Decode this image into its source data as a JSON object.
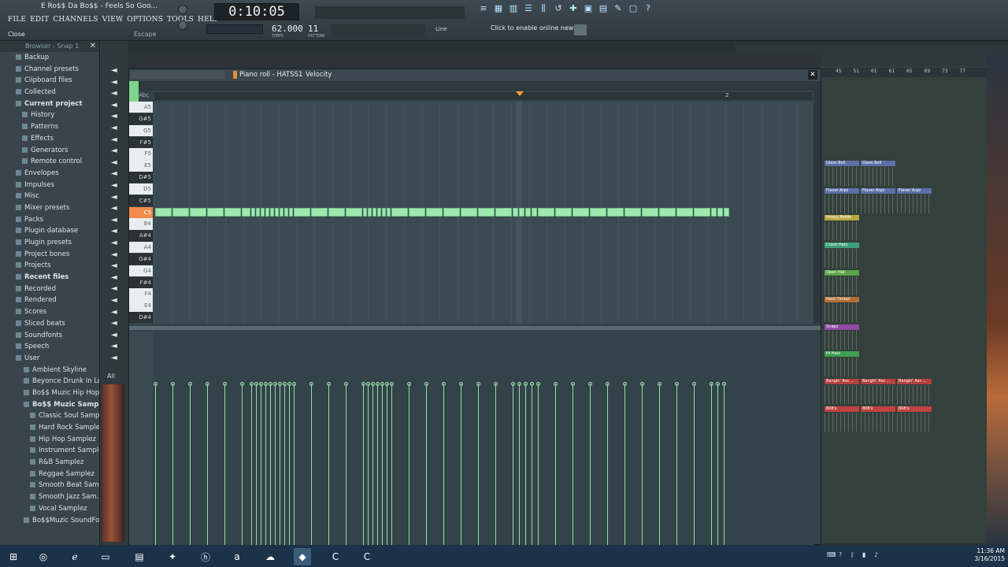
{
  "window": {
    "title": "E Ro$$ Da Bo$$ - Feels So Goo...",
    "menu": [
      "FILE",
      "EDIT",
      "CHANNELS",
      "VIEW",
      "OPTIONS",
      "TOOLS",
      "HELP"
    ],
    "hint_close": "Close",
    "hint_escape": "Escape"
  },
  "transport": {
    "time": "0:10:05",
    "tempo": "62.000",
    "tempo_label": "TEMPO",
    "pattern": "11",
    "pattern_label": "PATTERN",
    "mode": "Line",
    "news": "Click to enable online news"
  },
  "browser": {
    "header": "Browser - Snap 1",
    "items": [
      {
        "label": "Backup",
        "bold": false
      },
      {
        "label": "Channel presets",
        "bold": false
      },
      {
        "label": "Clipboard files",
        "bold": false
      },
      {
        "label": "Collected",
        "bold": false
      },
      {
        "label": "Current project",
        "bold": true
      },
      {
        "label": "History",
        "bold": false
      },
      {
        "label": "Patterns",
        "bold": false
      },
      {
        "label": "Effects",
        "bold": false
      },
      {
        "label": "Generators",
        "bold": false
      },
      {
        "label": "Remote control",
        "bold": false
      },
      {
        "label": "Envelopes",
        "bold": false
      },
      {
        "label": "Impulses",
        "bold": false
      },
      {
        "label": "Misc",
        "bold": false
      },
      {
        "label": "Mixer presets",
        "bold": false
      },
      {
        "label": "Packs",
        "bold": false
      },
      {
        "label": "Plugin database",
        "bold": false
      },
      {
        "label": "Plugin presets",
        "bold": false
      },
      {
        "label": "Project bones",
        "bold": false
      },
      {
        "label": "Projects",
        "bold": false
      },
      {
        "label": "Recent files",
        "bold": true
      },
      {
        "label": "Recorded",
        "bold": false
      },
      {
        "label": "Rendered",
        "bold": false
      },
      {
        "label": "Scores",
        "bold": false
      },
      {
        "label": "Sliced beats",
        "bold": false
      },
      {
        "label": "Soundfonts",
        "bold": false
      },
      {
        "label": "Speech",
        "bold": false
      },
      {
        "label": "User",
        "bold": false
      },
      {
        "label": "Ambient Skyline",
        "bold": false
      },
      {
        "label": "Beyonce Drunk In Lo...",
        "bold": false
      },
      {
        "label": "Bo$$ Muzic Hip Hop Kit",
        "bold": false
      },
      {
        "label": "Bo$$ Muzic Samplez",
        "bold": true
      },
      {
        "label": "Classic Soul Samp...",
        "bold": false
      },
      {
        "label": "Hard Rock Samplez",
        "bold": false
      },
      {
        "label": "Hip Hop Samplez",
        "bold": false
      },
      {
        "label": "Instrument Samplez",
        "bold": false
      },
      {
        "label": "R&B Samplez",
        "bold": false
      },
      {
        "label": "Reggae Samplez",
        "bold": false
      },
      {
        "label": "Smooth Beat Sam...",
        "bold": false
      },
      {
        "label": "Smooth Jazz Sam...",
        "bold": false
      },
      {
        "label": "Vocal Samplez",
        "bold": false
      },
      {
        "label": "Bo$$Muzic SoundFo...",
        "bold": false
      }
    ],
    "all_label": "All"
  },
  "piano_roll": {
    "title": "Piano roll - HATSS1",
    "target": "Velocity",
    "bar_label": "2",
    "keys": [
      "A5",
      "G#5",
      "G5",
      "F#5",
      "F5",
      "E5",
      "D#5",
      "D5",
      "C#5",
      "C5",
      "B4",
      "A#4",
      "A4",
      "G#4",
      "G4",
      "F#4",
      "F4",
      "E4",
      "D#4"
    ],
    "highlight_key": "C5",
    "note_row": "C5"
  },
  "playlist": {
    "ruler": [
      "45",
      "51",
      "61",
      "61",
      "65",
      "69",
      "73",
      "77"
    ],
    "clips": [
      {
        "label": "Glass Bell",
        "color": "#5f6fa8"
      },
      {
        "label": "Glass Bell",
        "color": "#5f6fa8"
      },
      {
        "label": "Flaver Arpz",
        "color": "#5f6fa8"
      },
      {
        "label": "Flaver Arpz",
        "color": "#5f6fa8"
      },
      {
        "label": "Flaver Arpz",
        "color": "#5f6fa8"
      },
      {
        "label": "Heavy Bottle",
        "color": "#b8a642"
      },
      {
        "label": "Crash Hatz",
        "color": "#3f9e7a"
      },
      {
        "label": "Open Hat",
        "color": "#5aa348"
      },
      {
        "label": "Hard Timbal",
        "color": "#b5703a"
      },
      {
        "label": "Snapz",
        "color": "#8d4ca6"
      },
      {
        "label": "Hi Hatz",
        "color": "#3f9e52"
      },
      {
        "label": "Bangin' Ass ...",
        "color": "#b2403e"
      },
      {
        "label": "Bangin' Ass ...",
        "color": "#b2403e"
      },
      {
        "label": "Bangin' Ass ...",
        "color": "#b2403e"
      },
      {
        "label": "808's",
        "color": "#c24242"
      },
      {
        "label": "808's",
        "color": "#c24242"
      },
      {
        "label": "808's",
        "color": "#c24242"
      }
    ]
  },
  "taskbar": {
    "time": "11:36 AM",
    "date": "3/16/2015"
  }
}
